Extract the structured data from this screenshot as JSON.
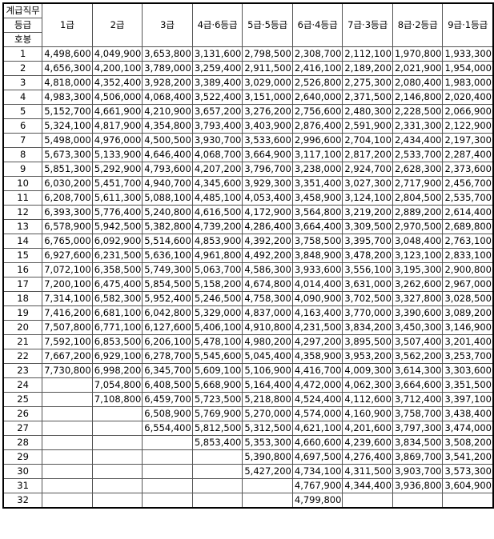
{
  "table": {
    "header_labels": [
      "계급직무",
      "등급",
      "호봉"
    ],
    "grades": [
      "1급",
      "2급",
      "3급",
      "4급·6등급",
      "5급·5등급",
      "6급·4등급",
      "7급·3등급",
      "8급·2등급",
      "9급·1등급"
    ],
    "rows": [
      {
        "step": "1",
        "cells": [
          "4,498,600",
          "4,049,900",
          "3,653,800",
          "3,131,600",
          "2,798,500",
          "2,308,700",
          "2,112,100",
          "1,970,800",
          "1,933,300"
        ]
      },
      {
        "step": "2",
        "cells": [
          "4,656,300",
          "4,200,100",
          "3,789,000",
          "3,259,400",
          "2,911,500",
          "2,416,100",
          "2,189,200",
          "2,021,900",
          "1,954,000"
        ]
      },
      {
        "step": "3",
        "cells": [
          "4,818,000",
          "4,352,400",
          "3,928,200",
          "3,389,400",
          "3,029,000",
          "2,526,800",
          "2,275,300",
          "2,080,400",
          "1,983,000"
        ]
      },
      {
        "step": "4",
        "cells": [
          "4,983,300",
          "4,506,000",
          "4,068,400",
          "3,522,400",
          "3,151,000",
          "2,640,000",
          "2,371,500",
          "2,146,800",
          "2,020,400"
        ]
      },
      {
        "step": "5",
        "cells": [
          "5,152,700",
          "4,661,900",
          "4,210,900",
          "3,657,200",
          "3,276,200",
          "2,756,600",
          "2,480,300",
          "2,228,500",
          "2,066,900"
        ]
      },
      {
        "step": "6",
        "cells": [
          "5,324,100",
          "4,817,900",
          "4,354,800",
          "3,793,400",
          "3,403,900",
          "2,876,400",
          "2,591,900",
          "2,331,300",
          "2,122,900"
        ]
      },
      {
        "step": "7",
        "cells": [
          "5,498,000",
          "4,976,000",
          "4,500,500",
          "3,930,700",
          "3,533,600",
          "2,996,600",
          "2,704,100",
          "2,434,400",
          "2,197,300"
        ]
      },
      {
        "step": "8",
        "cells": [
          "5,673,300",
          "5,133,900",
          "4,646,400",
          "4,068,700",
          "3,664,900",
          "3,117,100",
          "2,817,200",
          "2,533,700",
          "2,287,400"
        ]
      },
      {
        "step": "9",
        "cells": [
          "5,851,300",
          "5,292,900",
          "4,793,600",
          "4,207,200",
          "3,796,700",
          "3,238,000",
          "2,924,700",
          "2,628,300",
          "2,373,600"
        ]
      },
      {
        "step": "10",
        "cells": [
          "6,030,200",
          "5,451,700",
          "4,940,700",
          "4,345,600",
          "3,929,300",
          "3,351,400",
          "3,027,300",
          "2,717,900",
          "2,456,700"
        ]
      },
      {
        "step": "11",
        "cells": [
          "6,208,700",
          "5,611,300",
          "5,088,100",
          "4,485,100",
          "4,053,400",
          "3,458,900",
          "3,124,100",
          "2,804,500",
          "2,535,700"
        ]
      },
      {
        "step": "12",
        "cells": [
          "6,393,300",
          "5,776,400",
          "5,240,800",
          "4,616,500",
          "4,172,900",
          "3,564,800",
          "3,219,200",
          "2,889,200",
          "2,614,400"
        ]
      },
      {
        "step": "13",
        "cells": [
          "6,578,900",
          "5,942,500",
          "5,382,800",
          "4,739,200",
          "4,286,400",
          "3,664,400",
          "3,309,500",
          "2,970,500",
          "2,689,800"
        ]
      },
      {
        "step": "14",
        "cells": [
          "6,765,000",
          "6,092,900",
          "5,514,600",
          "4,853,900",
          "4,392,200",
          "3,758,500",
          "3,395,700",
          "3,048,400",
          "2,763,100"
        ]
      },
      {
        "step": "15",
        "cells": [
          "6,927,600",
          "6,231,500",
          "5,636,100",
          "4,961,800",
          "4,492,200",
          "3,848,900",
          "3,478,200",
          "3,123,100",
          "2,833,100"
        ]
      },
      {
        "step": "16",
        "cells": [
          "7,072,100",
          "6,358,500",
          "5,749,300",
          "5,063,700",
          "4,586,300",
          "3,933,600",
          "3,556,100",
          "3,195,300",
          "2,900,800"
        ]
      },
      {
        "step": "17",
        "cells": [
          "7,200,100",
          "6,475,400",
          "5,854,500",
          "5,158,200",
          "4,674,800",
          "4,014,400",
          "3,631,000",
          "3,262,600",
          "2,967,000"
        ]
      },
      {
        "step": "18",
        "cells": [
          "7,314,100",
          "6,582,300",
          "5,952,400",
          "5,246,500",
          "4,758,300",
          "4,090,900",
          "3,702,500",
          "3,327,800",
          "3,028,500"
        ]
      },
      {
        "step": "19",
        "cells": [
          "7,416,200",
          "6,681,100",
          "6,042,800",
          "5,329,000",
          "4,837,000",
          "4,163,400",
          "3,770,000",
          "3,390,600",
          "3,089,200"
        ]
      },
      {
        "step": "20",
        "cells": [
          "7,507,800",
          "6,771,100",
          "6,127,600",
          "5,406,100",
          "4,910,800",
          "4,231,500",
          "3,834,200",
          "3,450,300",
          "3,146,900"
        ]
      },
      {
        "step": "21",
        "cells": [
          "7,592,100",
          "6,853,500",
          "6,206,100",
          "5,478,100",
          "4,980,200",
          "4,297,200",
          "3,895,500",
          "3,507,400",
          "3,201,400"
        ]
      },
      {
        "step": "22",
        "cells": [
          "7,667,200",
          "6,929,100",
          "6,278,700",
          "5,545,600",
          "5,045,400",
          "4,358,900",
          "3,953,200",
          "3,562,200",
          "3,253,700"
        ]
      },
      {
        "step": "23",
        "cells": [
          "7,730,800",
          "6,998,200",
          "6,345,700",
          "5,609,100",
          "5,106,900",
          "4,416,700",
          "4,009,300",
          "3,614,300",
          "3,303,600"
        ]
      },
      {
        "step": "24",
        "cells": [
          "",
          "7,054,800",
          "6,408,500",
          "5,668,900",
          "5,164,400",
          "4,472,000",
          "4,062,300",
          "3,664,600",
          "3,351,500"
        ]
      },
      {
        "step": "25",
        "cells": [
          "",
          "7,108,800",
          "6,459,700",
          "5,723,500",
          "5,218,800",
          "4,524,400",
          "4,112,600",
          "3,712,400",
          "3,397,100"
        ]
      },
      {
        "step": "26",
        "cells": [
          "",
          "",
          "6,508,900",
          "5,769,900",
          "5,270,000",
          "4,574,000",
          "4,160,900",
          "3,758,700",
          "3,438,400"
        ]
      },
      {
        "step": "27",
        "cells": [
          "",
          "",
          "6,554,400",
          "5,812,500",
          "5,312,500",
          "4,621,100",
          "4,201,600",
          "3,797,300",
          "3,474,000"
        ]
      },
      {
        "step": "28",
        "cells": [
          "",
          "",
          "",
          "5,853,400",
          "5,353,300",
          "4,660,600",
          "4,239,600",
          "3,834,500",
          "3,508,200"
        ]
      },
      {
        "step": "29",
        "cells": [
          "",
          "",
          "",
          "",
          "5,390,800",
          "4,697,500",
          "4,276,400",
          "3,869,700",
          "3,541,200"
        ]
      },
      {
        "step": "30",
        "cells": [
          "",
          "",
          "",
          "",
          "5,427,200",
          "4,734,100",
          "4,311,500",
          "3,903,700",
          "3,573,300"
        ]
      },
      {
        "step": "31",
        "cells": [
          "",
          "",
          "",
          "",
          "",
          "4,767,900",
          "4,344,400",
          "3,936,800",
          "3,604,900"
        ]
      },
      {
        "step": "32",
        "cells": [
          "",
          "",
          "",
          "",
          "",
          "4,799,800",
          "",
          "",
          ""
        ]
      }
    ]
  }
}
